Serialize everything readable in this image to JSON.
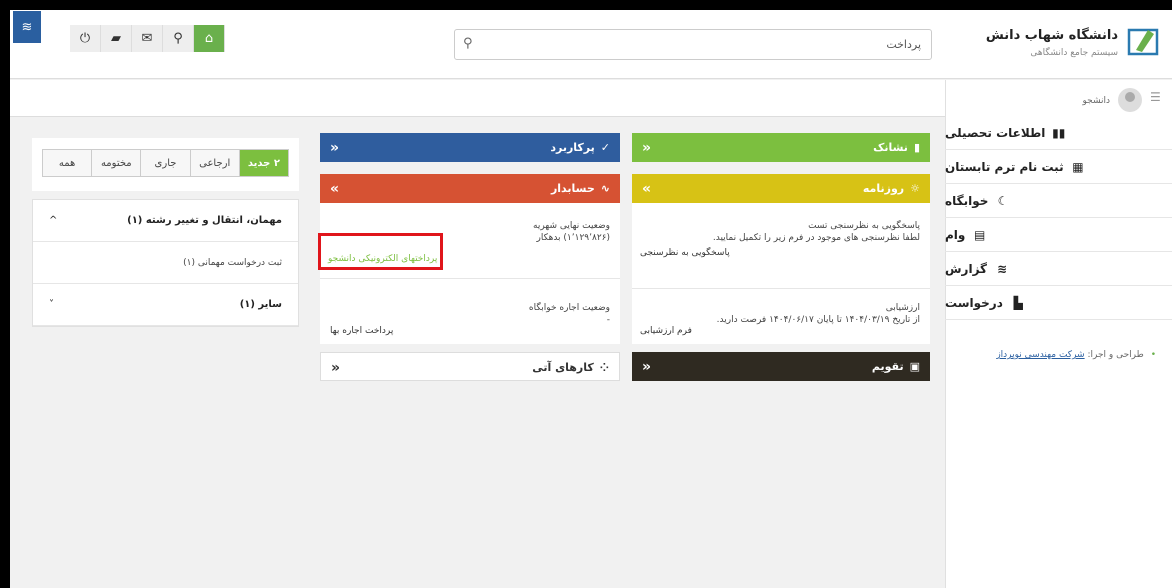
{
  "header": {
    "search_icon": "search-icon",
    "search_value": "پرداخت",
    "university_title": "دانشگاه شهاب دانش",
    "university_subtitle": "سیستم جامع دانشگاهی",
    "toolbar_icons": [
      "home-icon",
      "user-icon",
      "envelope-icon",
      "folder-icon",
      "power-icon"
    ],
    "layers_icon": "layers-icon"
  },
  "sidebar": {
    "user_name": "دانشجو",
    "items": [
      {
        "label": "اطلاعات تحصیلی",
        "icon": "book-icon"
      },
      {
        "label": "ثبت نام ترم تابستان",
        "icon": "grid-icon"
      },
      {
        "label": "خوابگاه",
        "icon": "moon-icon"
      },
      {
        "label": "وام",
        "icon": "card-icon"
      },
      {
        "label": "گزارش",
        "icon": "layers-icon"
      },
      {
        "label": "درخواست",
        "icon": "document-icon"
      }
    ],
    "credit_prefix": "طراحی و اجرا:",
    "credit_company": "شرکت مهندسی نوپرداز"
  },
  "cards": {
    "neshanak": {
      "title": "نشانک",
      "chevron": "«"
    },
    "karbord": {
      "title": "پرکاربرد",
      "chevron": "«"
    },
    "roozname": {
      "title": "روزنامه",
      "chevron": "»",
      "item1_line1": "پاسخگویی به نظرسنجی تست",
      "item1_line2": "لطفا نظرسنجی های موجود در فرم زیر را تکمیل نمایید.",
      "item1_link": "پاسخگویی به نظرسنجی",
      "item2_line1": "ارزشیابی",
      "item2_line2": "از تاریخ ۱۴۰۴/۰۳/۱۹ تا پایان ۱۴۰۴/۰۶/۱۷ فرصت دارید.",
      "item2_link": "فرم ارزشیابی"
    },
    "hesabdar": {
      "title": "حسابدار",
      "chevron": "»",
      "item1_line1": "وضعیت نهایی شهریه",
      "item1_line2": "(۱٬۱۲۹٬۸۲۶) بدهکار",
      "item1_link": "پرداختهای الکترونیکی دانشجو",
      "item2_line1": "وضعیت اجاره خوابگاه",
      "item2_line2": "-",
      "item2_link": "پرداخت اجاره بها"
    },
    "taghvim": {
      "title": "تقویم",
      "chevron": "«"
    },
    "karha": {
      "title": "کارهای آتی",
      "chevron": "«"
    }
  },
  "requests": {
    "tabs": [
      "۲ جدید",
      "ارجاعی",
      "جاری",
      "مختومه",
      "همه"
    ],
    "rows": [
      {
        "label": "مهمان، انتقال و تغییر رشته (۱)",
        "chevron": "^"
      },
      {
        "label": "ثبت درخواست مهمانی (۱)",
        "chevron": ""
      },
      {
        "label": "سایر (۱)",
        "chevron": "˅"
      }
    ]
  },
  "colors": {
    "green": "#7cbf3f",
    "blue": "#2f5d9e",
    "orange": "#d65233",
    "yellow": "#d7c215",
    "dark": "#2f2a21",
    "highlight": "#e0151b"
  }
}
